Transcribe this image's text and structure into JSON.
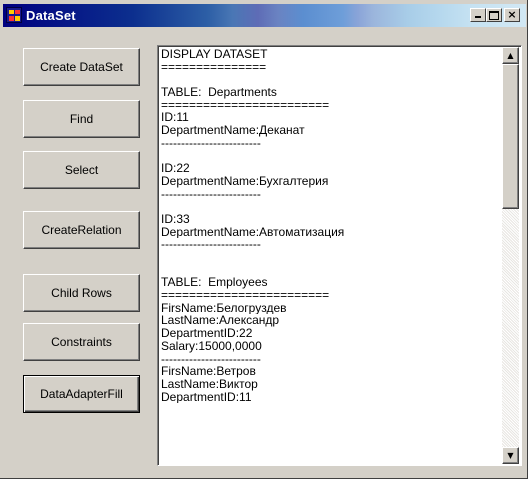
{
  "window": {
    "title": "DataSet",
    "minimize_glyph": "_",
    "maximize_glyph": "□",
    "close_glyph": "×"
  },
  "buttons": [
    {
      "label": "Create DataSet"
    },
    {
      "label": "Find"
    },
    {
      "label": "Select"
    },
    {
      "label": "CreateRelation"
    },
    {
      "label": "Child Rows"
    },
    {
      "label": "Constraints"
    },
    {
      "label": "DataAdapterFill"
    }
  ],
  "output_lines": [
    "DISPLAY DATASET",
    "===============",
    "",
    "TABLE:  Departments",
    "========================",
    "ID:11",
    "DepartmentName:Деканат",
    "-------------------------",
    "",
    "ID:22",
    "DepartmentName:Бухгалтерия",
    "-------------------------",
    "",
    "ID:33",
    "DepartmentName:Автоматизация",
    "-------------------------",
    "",
    "",
    "TABLE:  Employees",
    "========================",
    "FirsName:Белогруздев",
    "LastName:Александр",
    "DepartmentID:22",
    "Salary:15000,0000",
    "-------------------------",
    "FirsName:Ветров",
    "LastName:Виктор",
    "DepartmentID:11"
  ],
  "scrollbar": {
    "up_arrow": "▲",
    "down_arrow": "▼",
    "position_fraction": 0.0
  }
}
